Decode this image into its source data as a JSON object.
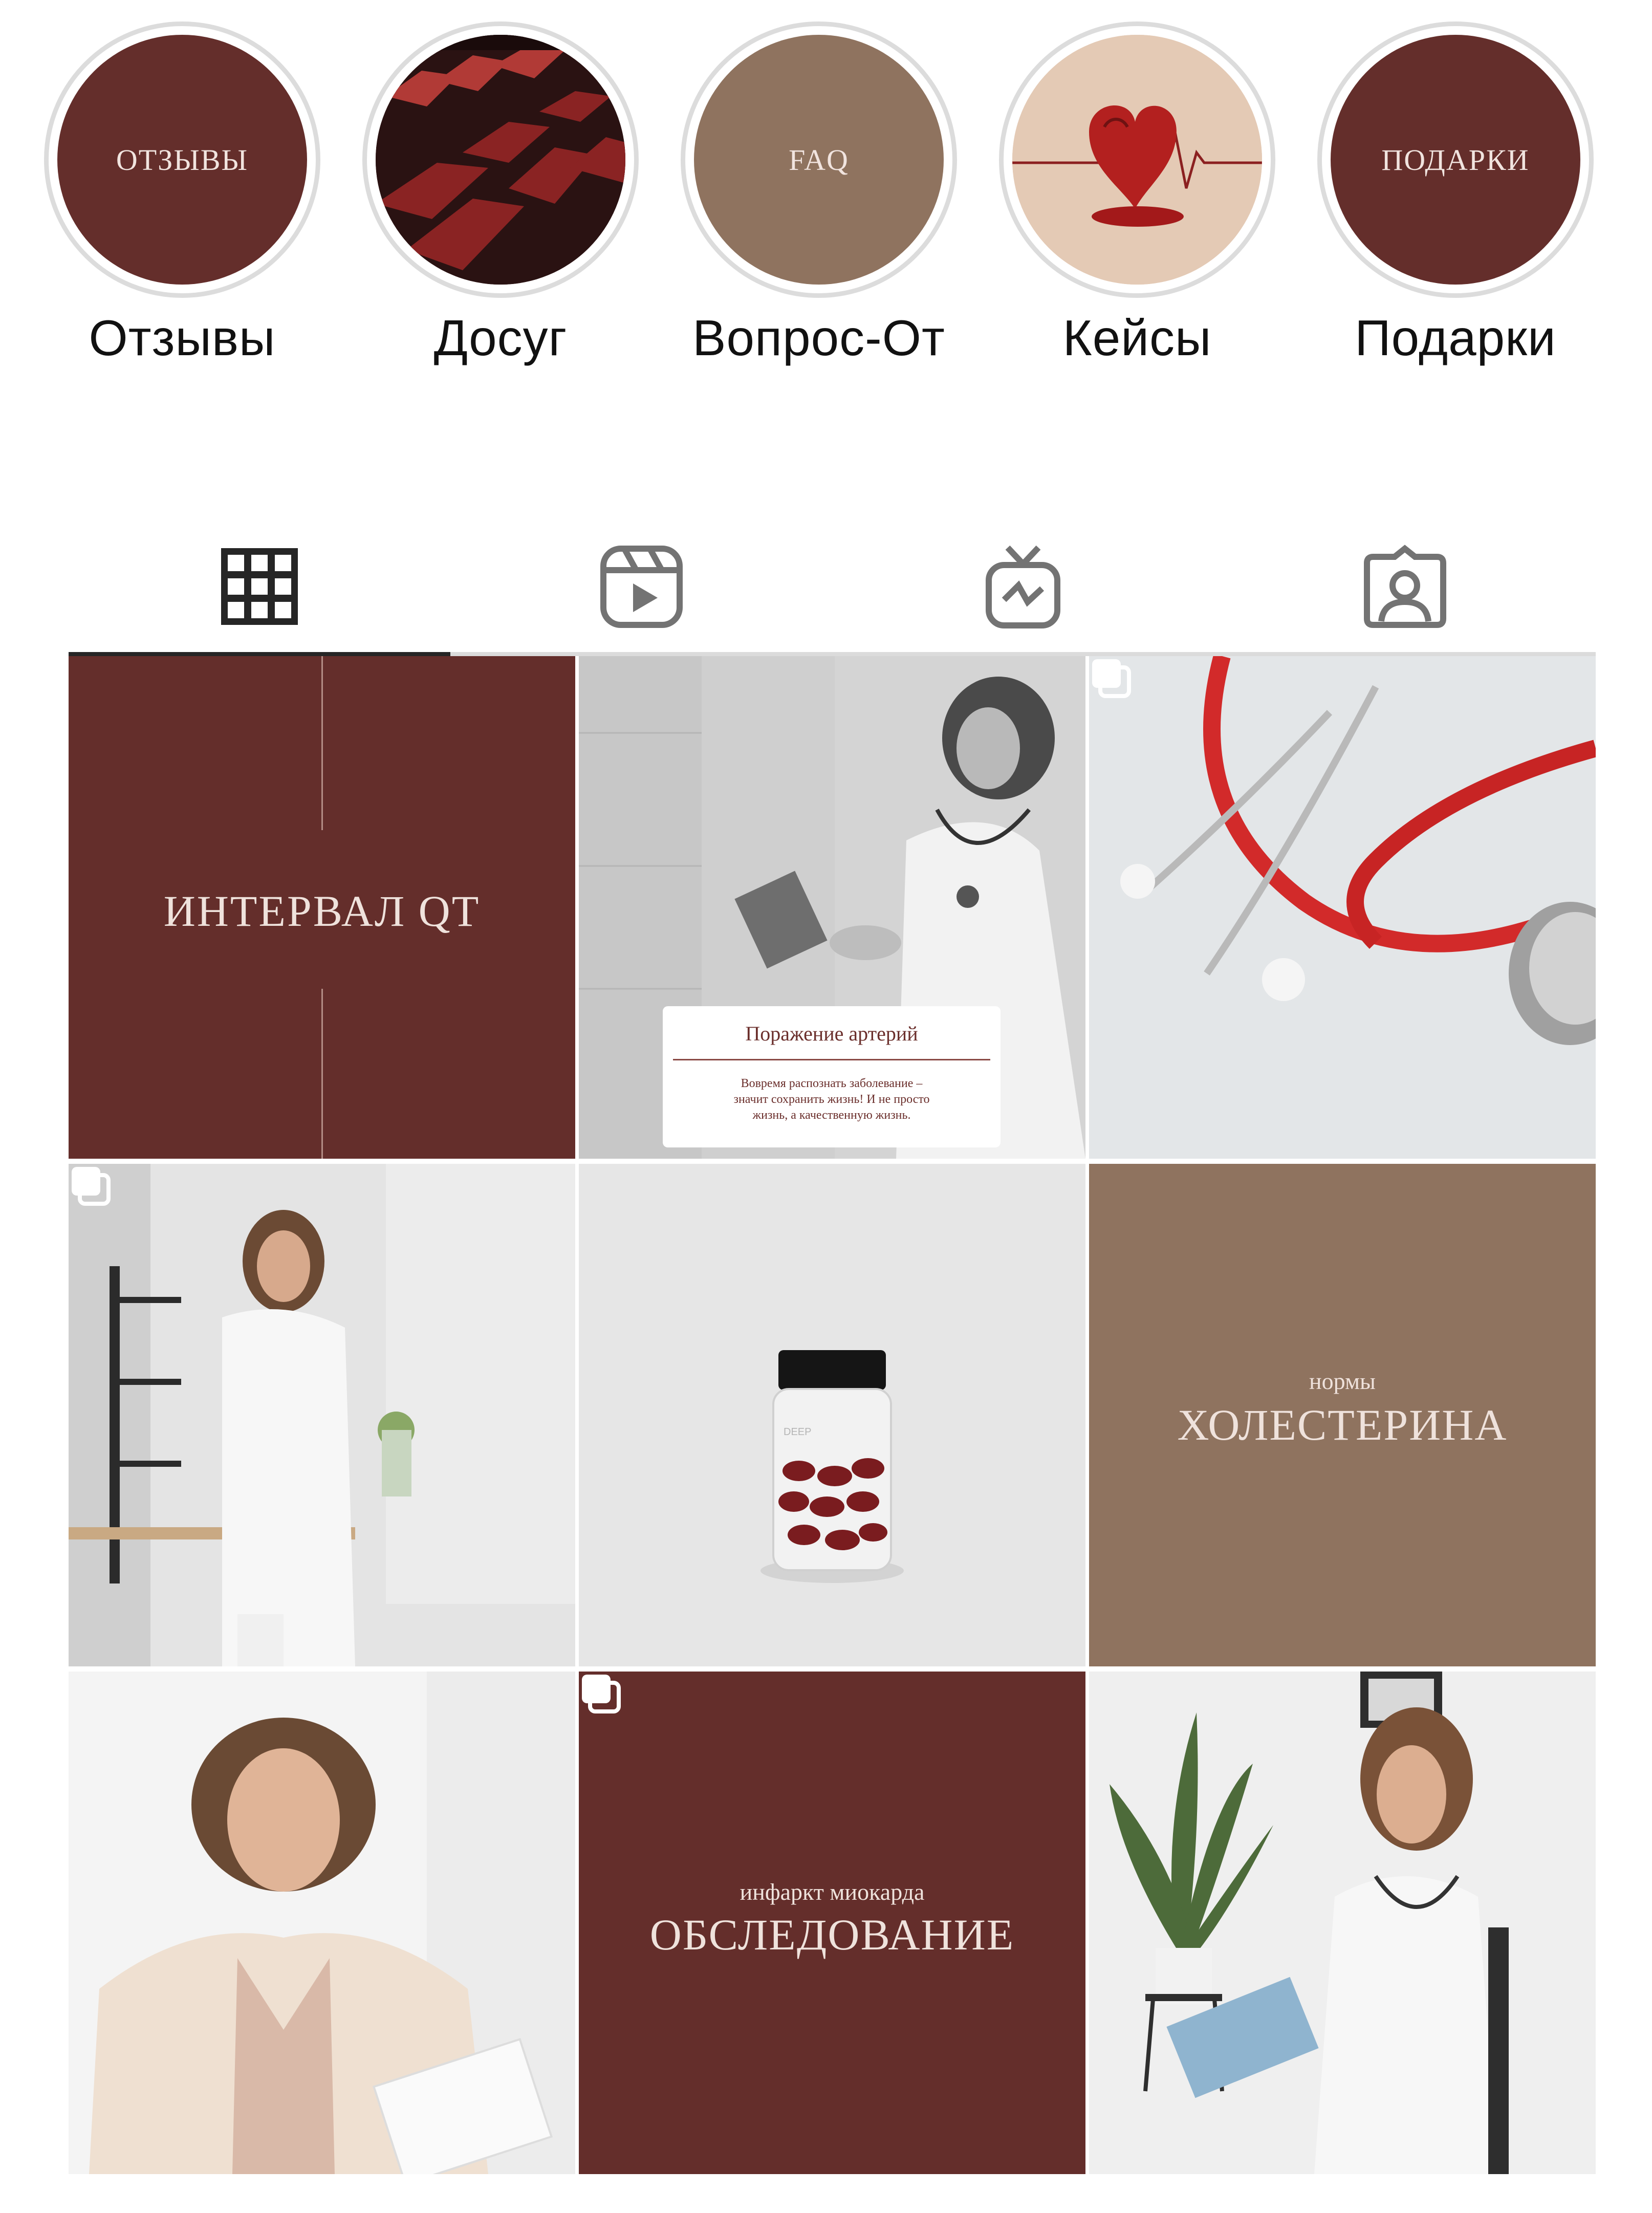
{
  "highlights": [
    {
      "label": "Отзывы",
      "cover_text": "ОТЗЫВЫ",
      "cover_color": "#642e2b"
    },
    {
      "label": "Досуг",
      "cover_text": "",
      "cover_color": "#3a1a1a"
    },
    {
      "label": "Вопрос-От",
      "cover_text": "FAQ",
      "cover_color": "#8f735f"
    },
    {
      "label": "Кейсы",
      "cover_text": "",
      "cover_color": "#e3c9b3"
    },
    {
      "label": "Подарки",
      "cover_text": "ПОДАРКИ",
      "cover_color": "#642e2b"
    }
  ],
  "tabs": [
    {
      "icon": "grid-icon",
      "active": true
    },
    {
      "icon": "reels-icon",
      "active": false
    },
    {
      "icon": "igtv-icon",
      "active": false
    },
    {
      "icon": "tagged-icon",
      "active": false
    }
  ],
  "posts": {
    "interval_qt": {
      "title": "ИНТЕРВАЛ QT",
      "bg": "#642e2b"
    },
    "arteries": {
      "card_title": "Поражение артерий",
      "card_text_1": "Вовремя распознать заболевание –",
      "card_text_2": "значит сохранить жизнь! И не просто",
      "card_text_3": "жизнь, а качественную жизнь."
    },
    "cholesterol": {
      "small": "нормы",
      "title": "ХОЛЕСТЕРИНА",
      "bg": "#8f735f"
    },
    "infarction": {
      "small": "инфаркт миокарда",
      "title": "ОБСЛЕДОВАНИЕ",
      "bg": "#642e2b"
    },
    "capsule_label": "DEEP"
  },
  "colors": {
    "brand_dark": "#642e2b",
    "brand_light": "#8f735f",
    "text": "#111111"
  }
}
